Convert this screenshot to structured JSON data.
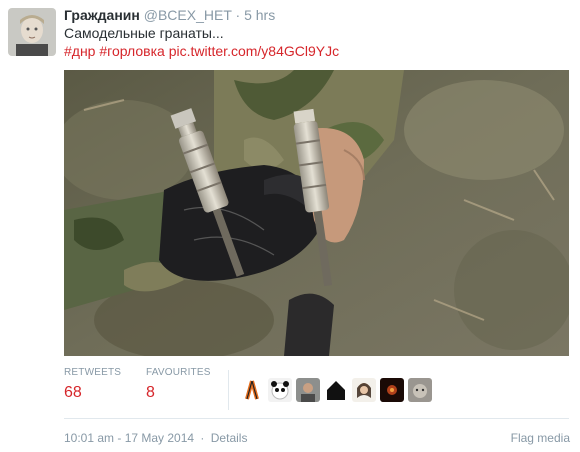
{
  "tweet": {
    "fullname": "Гражданин",
    "username": "@BCEX_HET",
    "dot": "·",
    "time": "5 hrs",
    "text": "Самодельные гранаты...",
    "hashtag1": "#днр",
    "hashtag2": "#горловка",
    "pic_link": "pic.twitter.com/y84GCl9YJc"
  },
  "stats": {
    "retweets_label": "RETWEETS",
    "retweets_value": "68",
    "favourites_label": "FAVOURITES",
    "favourites_value": "8"
  },
  "footer": {
    "timestamp": "10:01 am - 17 May 2014",
    "separator": "·",
    "details": "Details",
    "flag_media": "Flag media"
  },
  "favoriter_avatars": [
    "ribbon-avatar",
    "panda-avatar",
    "man-avatar",
    "house-avatar",
    "woman-avatar",
    "dark-avatar",
    "cat-avatar"
  ],
  "colors": {
    "link": "#d6262b",
    "muted": "#8899a6",
    "text": "#292f33"
  }
}
